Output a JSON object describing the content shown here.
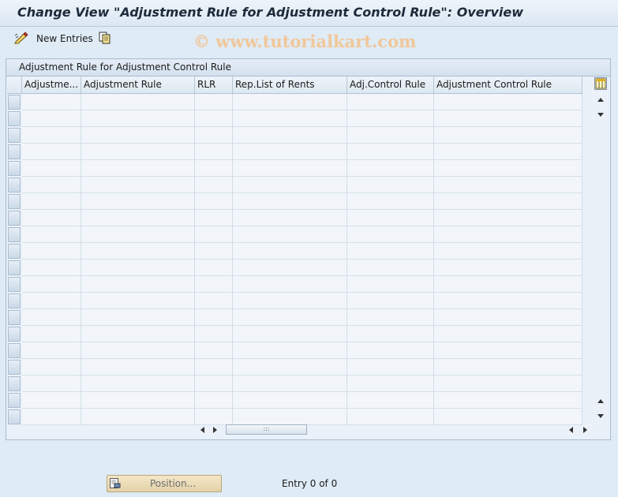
{
  "window": {
    "title": "Change View \"Adjustment Rule for Adjustment Control Rule\": Overview"
  },
  "toolbar": {
    "new_entries_label": "New Entries"
  },
  "watermark": "© www.tutorialkart.com",
  "table": {
    "title": "Adjustment Rule for Adjustment Control Rule",
    "columns": [
      "Adjustme...",
      "Adjustment Rule",
      "RLR",
      "Rep.List of Rents",
      "Adj.Control Rule",
      "Adjustment Control Rule"
    ],
    "empty_rows": 20
  },
  "footer": {
    "position_button": "Position...",
    "entry_text": "Entry 0 of 0"
  }
}
